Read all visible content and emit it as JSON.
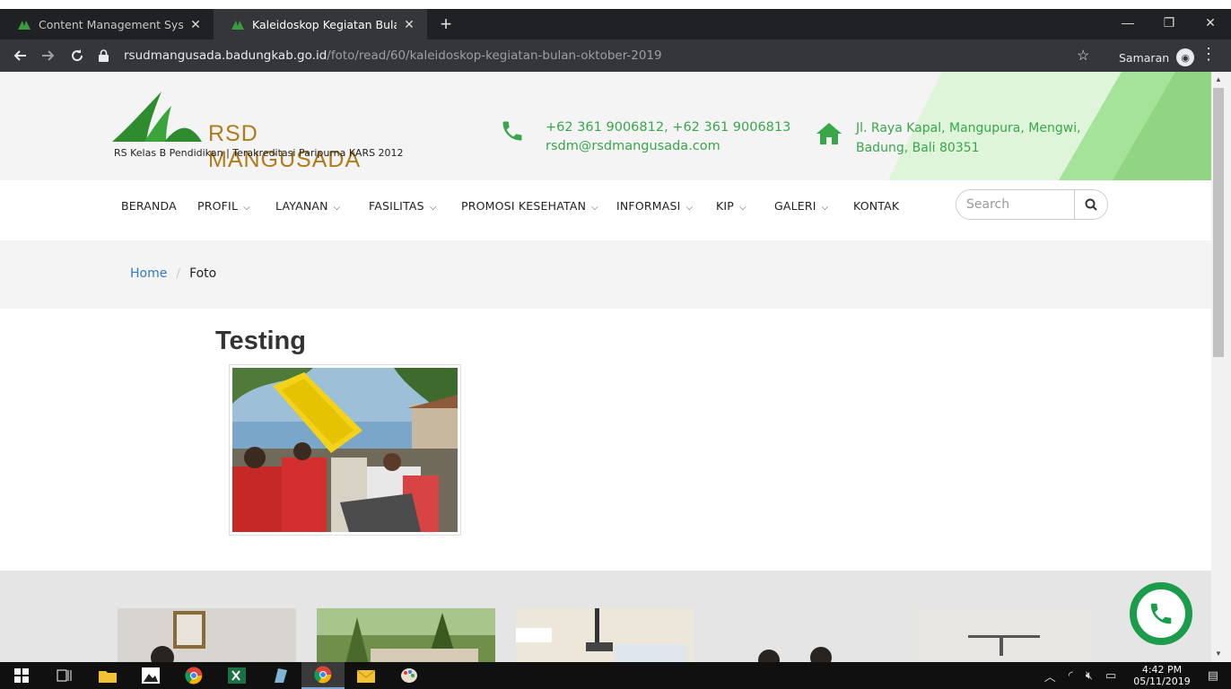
{
  "browser": {
    "tabs": [
      {
        "title": "Content Management System",
        "active": false
      },
      {
        "title": "Kaleidoskop Kegiatan Bulan Oktob",
        "active": true
      }
    ],
    "new_tab_symbol": "+",
    "window_controls": {
      "minimize": "—",
      "restore": "❐",
      "close": "✕"
    },
    "url_host": "rsudmangusada.badungkab.go.id",
    "url_path": "/foto/read/60/kaleidoskop-kegiatan-bulan-oktober-2019",
    "profile_name": "Samaran"
  },
  "header": {
    "logo_title": "RSD MANGUSADA",
    "logo_subtitle": "RS Kelas B Pendidikan  |  Terakreditasi Paripurna KARS 2012",
    "phone": "+62 361 9006812, +62 361 9006813",
    "email": "rsdm@rsdmangusada.com",
    "address_line1": "Jl. Raya Kapal, Mangupura, Mengwi,",
    "address_line2": "Badung, Bali 80351",
    "accent_color": "#39a64a"
  },
  "nav": {
    "items": [
      {
        "label": "BERANDA",
        "has_dropdown": false
      },
      {
        "label": "PROFIL",
        "has_dropdown": true
      },
      {
        "label": "LAYANAN",
        "has_dropdown": true
      },
      {
        "label": "FASILITAS",
        "has_dropdown": true
      },
      {
        "label": "PROMOSI KESEHATAN",
        "has_dropdown": true
      },
      {
        "label": "INFORMASI",
        "has_dropdown": true
      },
      {
        "label": "KIP",
        "has_dropdown": true
      },
      {
        "label": "GALERI",
        "has_dropdown": true
      },
      {
        "label": "KONTAK",
        "has_dropdown": false
      }
    ],
    "search_placeholder": "Search"
  },
  "breadcrumb": {
    "home": "Home",
    "separator": "/",
    "current": "Foto"
  },
  "content": {
    "title": "Testing"
  },
  "taskbar": {
    "time": "4:42 PM",
    "date": "05/11/2019"
  }
}
